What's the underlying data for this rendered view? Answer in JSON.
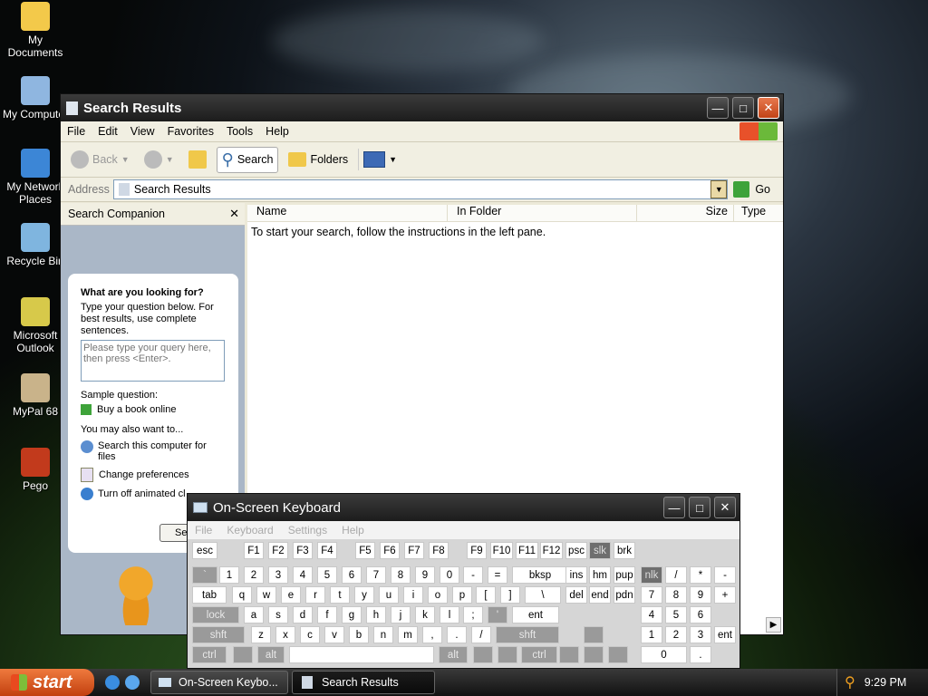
{
  "desktop_icons": [
    {
      "label": "My Documents",
      "name": "my-documents-icon",
      "color": "#f3c94a"
    },
    {
      "label": "My Computer",
      "name": "my-computer-icon",
      "color": "#8fb6e0"
    },
    {
      "label": "My Network Places",
      "name": "network-places-icon",
      "color": "#3c86d6"
    },
    {
      "label": "Recycle Bin",
      "name": "recycle-bin-icon",
      "color": "#7fb5df"
    },
    {
      "label": "Microsoft Outlook",
      "name": "outlook-icon",
      "color": "#d7c94a"
    },
    {
      "label": "MyPal 68",
      "name": "mypal-icon",
      "color": "#c9b38a"
    },
    {
      "label": "Pego",
      "name": "pego-icon",
      "color": "#c23a1c"
    }
  ],
  "explorer": {
    "title": "Search Results",
    "menu": [
      "File",
      "Edit",
      "View",
      "Favorites",
      "Tools",
      "Help"
    ],
    "toolbar": {
      "back": "Back",
      "search": "Search",
      "folders": "Folders"
    },
    "address_label": "Address",
    "address_value": "Search Results",
    "go": "Go",
    "companion_title": "Search Companion",
    "columns": [
      "Name",
      "In Folder",
      "Size",
      "Type"
    ],
    "empty_message": "To start your search, follow the instructions in the left pane.",
    "panel": {
      "heading": "What are you looking for?",
      "instructions": "Type your question below. For best results, use complete sentences.",
      "query_placeholder": "Please type your query here, then press <Enter>.",
      "sample_label": "Sample question:",
      "sample_link": "Buy a book online",
      "also_label": "You may also want to...",
      "link1": "Search this computer for files",
      "link2": "Change preferences",
      "link3": "Turn off animated cl",
      "search_btn": "Se"
    }
  },
  "osk": {
    "title": "On-Screen Keyboard",
    "menu": [
      "File",
      "Keyboard",
      "Settings",
      "Help"
    ],
    "rows": [
      [
        "esc",
        "F1",
        "F2",
        "F3",
        "F4",
        "F5",
        "F6",
        "F7",
        "F8",
        "F9",
        "F10",
        "F11",
        "F12",
        "psc",
        "slk",
        "brk"
      ],
      [
        "`",
        "1",
        "2",
        "3",
        "4",
        "5",
        "6",
        "7",
        "8",
        "9",
        "0",
        "-",
        "=",
        "bksp",
        "ins",
        "hm",
        "pup",
        "nlk",
        "/",
        "*",
        "-"
      ],
      [
        "tab",
        "q",
        "w",
        "e",
        "r",
        "t",
        "y",
        "u",
        "i",
        "o",
        "p",
        "[",
        "]",
        "\\",
        "del",
        "end",
        "pdn",
        "7",
        "8",
        "9",
        "+"
      ],
      [
        "lock",
        "a",
        "s",
        "d",
        "f",
        "g",
        "h",
        "j",
        "k",
        "l",
        ";",
        "'",
        "ent",
        "4",
        "5",
        "6"
      ],
      [
        "shft",
        "z",
        "x",
        "c",
        "v",
        "b",
        "n",
        "m",
        ",",
        ".",
        "/",
        "shft",
        "1",
        "2",
        "3",
        "ent"
      ],
      [
        "ctrl",
        "alt",
        "alt",
        "ctrl",
        "0",
        "."
      ]
    ]
  },
  "taskbar": {
    "start": "start",
    "tasks": [
      "On-Screen Keybo...",
      "Search Results"
    ],
    "clock": "9:29 PM"
  },
  "colors": {
    "taskbar": "#1a1a1a",
    "start": "#d9531e",
    "title_dark": "#2a2a2a"
  }
}
